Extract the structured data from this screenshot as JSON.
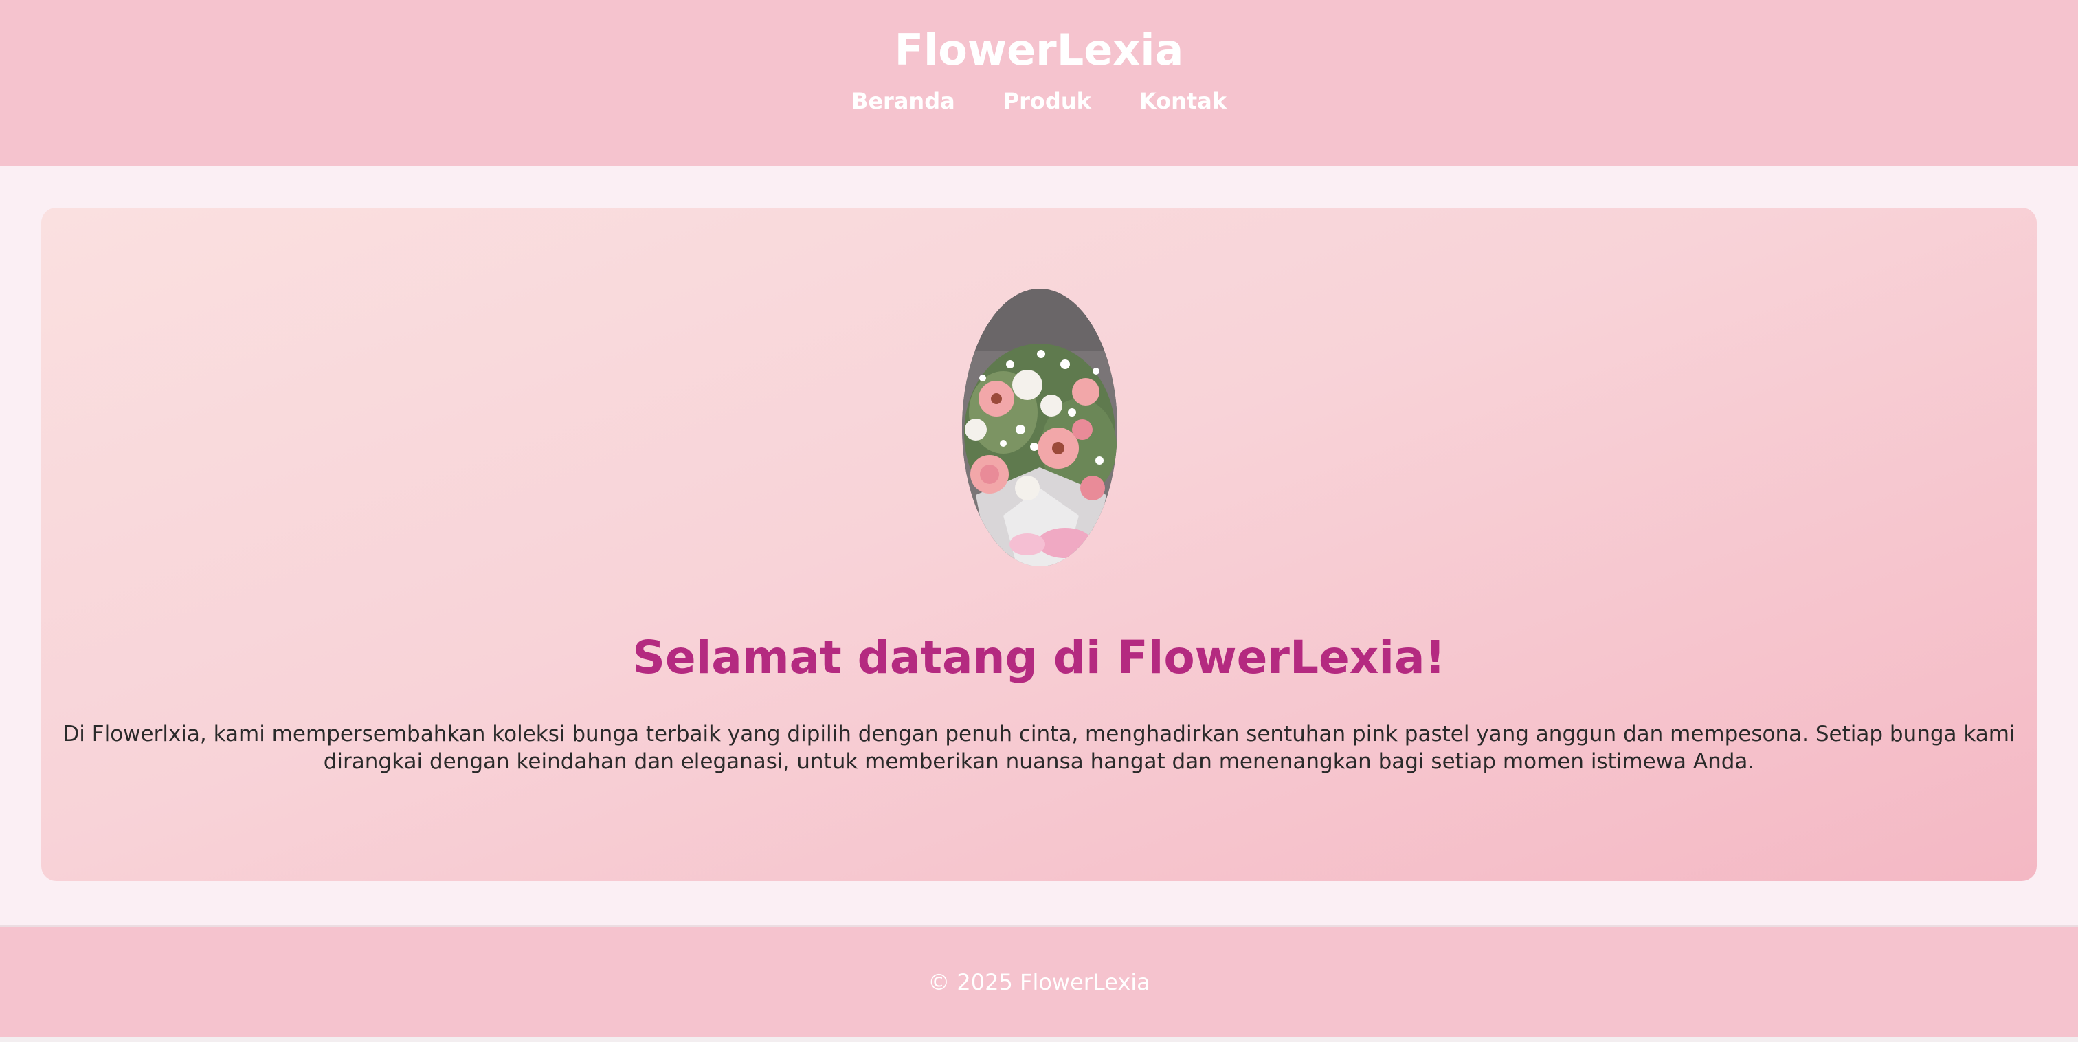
{
  "header": {
    "title": "FlowerLexia",
    "nav": [
      {
        "label": "Beranda"
      },
      {
        "label": "Produk"
      },
      {
        "label": "Kontak"
      }
    ]
  },
  "hero": {
    "image_icon": "flower-bouquet-image",
    "heading": "Selamat datang di FlowerLexia!",
    "text": "Di Flowerlxia, kami mempersembahkan koleksi bunga terbaik yang dipilih dengan penuh cinta, menghadirkan sentuhan pink pastel yang anggun dan mempesona. Setiap bunga kami dirangkai dengan keindahan dan eleganasi, untuk memberikan nuansa hangat dan menenangkan bagi setiap momen istimewa Anda."
  },
  "footer": {
    "text": "© 2025 FlowerLexia"
  },
  "colors": {
    "header_bg": "#f5c3ce",
    "page_bg": "#fbeff4",
    "heading_accent": "#b42a80",
    "text": "#2a2a2a"
  }
}
